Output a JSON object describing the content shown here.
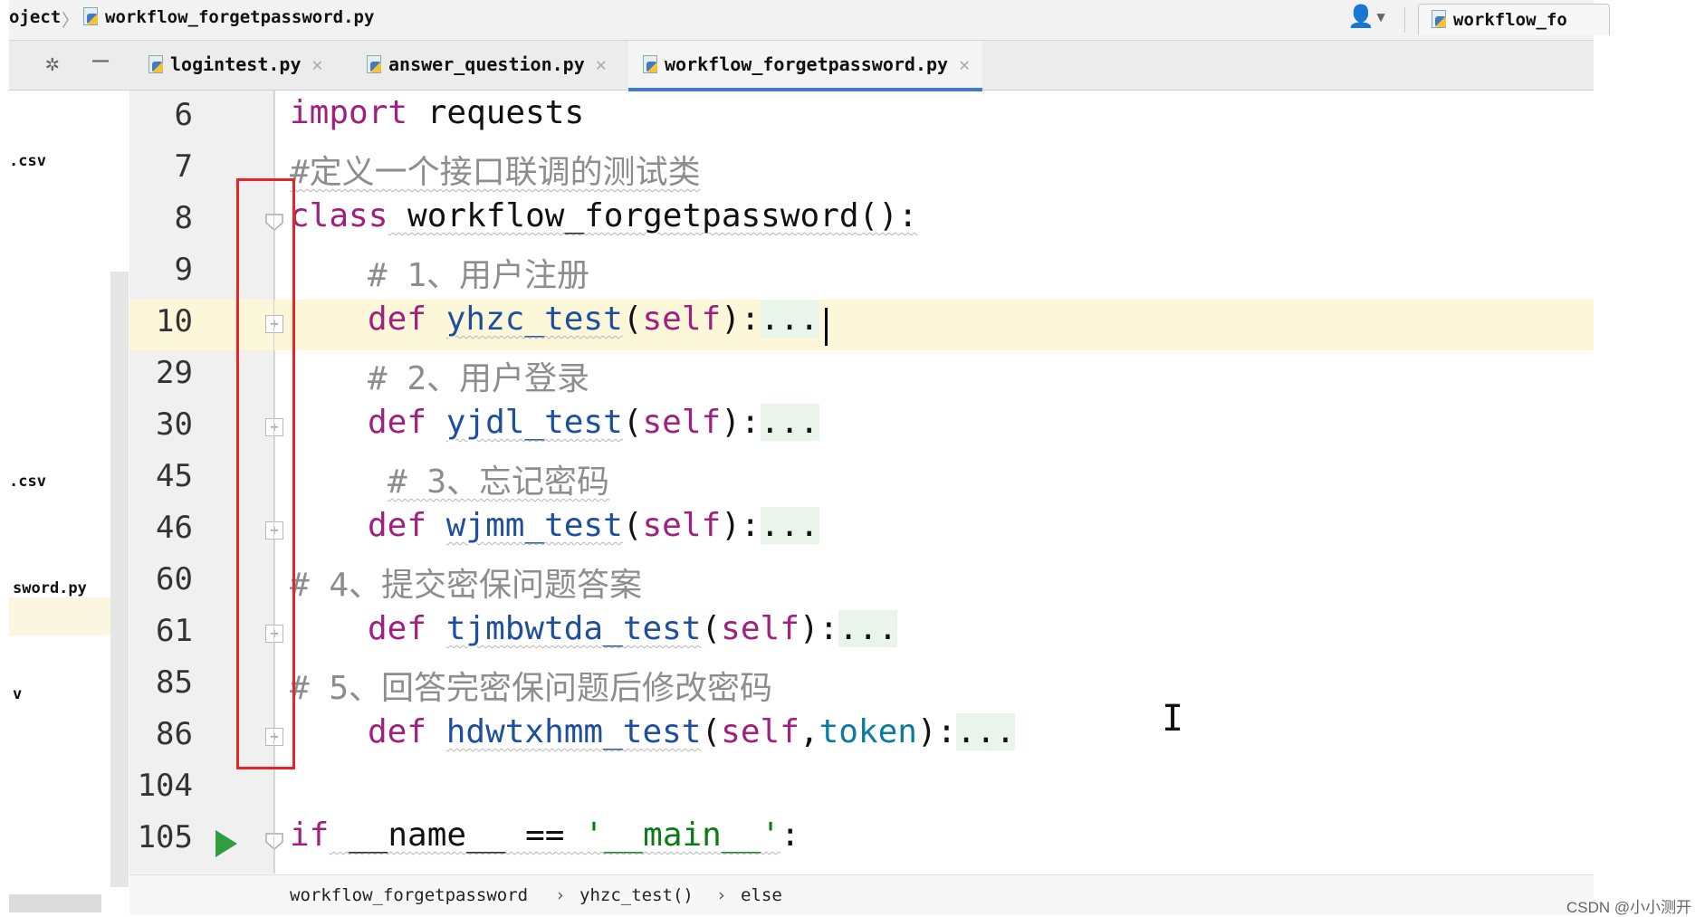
{
  "navbar": {
    "breadcrumb_project": "oject",
    "breadcrumb_file": "workflow_forgetpassword.py",
    "run_config_label": "workflow_fo"
  },
  "tabs": [
    {
      "label": "logintest.py"
    },
    {
      "label": "answer_question.py"
    },
    {
      "label": "workflow_forgetpassword.py"
    }
  ],
  "project_items": [
    ".csv",
    ".csv",
    "sword.py",
    "v"
  ],
  "line_numbers": [
    "6",
    "7",
    "8",
    "9",
    "10",
    "29",
    "30",
    "45",
    "46",
    "60",
    "61",
    "85",
    "86",
    "104",
    "105"
  ],
  "code": {
    "l6_kw": "import",
    "l6_rest": " requests",
    "l7_comment": "#定义一个接口联调的测试类",
    "l8_kw": "class",
    "l8_name": " workflow_forgetpassword",
    "l8_paren": "():",
    "l9_comment": "# 1、用户注册",
    "l10_kw": "def",
    "l10_fn": "yhzc_test",
    "l29_comment": "# 2、用户登录",
    "l30_kw": "def",
    "l30_fn": "yjdl_test",
    "l45_comment": "# 3、忘记密码",
    "l46_kw": "def",
    "l46_fn": "wjmm_test",
    "l60_comment": "# 4、提交密保问题答案",
    "l61_kw": "def",
    "l61_fn": "tjmbwtda_test",
    "l85_comment": "# 5、回答完密保问题后修改密码",
    "l86_kw": "def",
    "l86_fn": "hdwtxhmm_test",
    "l86_param": "token",
    "self": "self",
    "fold_dots": "...",
    "l105_kw": "if",
    "l105_name": " __name__ == ",
    "l105_str": "'__main__'",
    "l105_colon": ":"
  },
  "statusbar": {
    "crumb1": "workflow_forgetpassword",
    "crumb2": "yhzc_test()",
    "crumb3": "else",
    "separator": "›"
  },
  "watermark": "CSDN @小小测开",
  "colors": {
    "keyword": "#a01f7f",
    "function": "#1d4f9e",
    "comment": "#8d8d8d",
    "highlight": "#e4262a",
    "caret_line": "#fcf7d9"
  }
}
